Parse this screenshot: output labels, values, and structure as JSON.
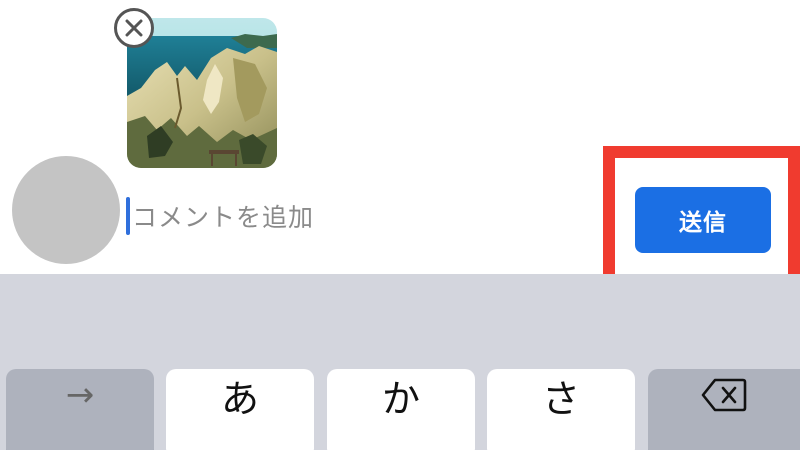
{
  "composer": {
    "attachment": {
      "remove_icon": "close-circle-icon"
    },
    "input": {
      "placeholder": "コメントを追加"
    },
    "send_label": "送信",
    "highlight_color": "#f03b2f",
    "send_color": "#1b6fe4"
  },
  "keyboard": {
    "keys": [
      {
        "label": "→",
        "icon": "arrow-right-icon"
      },
      {
        "label": "あ"
      },
      {
        "label": "か"
      },
      {
        "label": "さ"
      },
      {
        "icon": "backspace-icon"
      }
    ]
  }
}
